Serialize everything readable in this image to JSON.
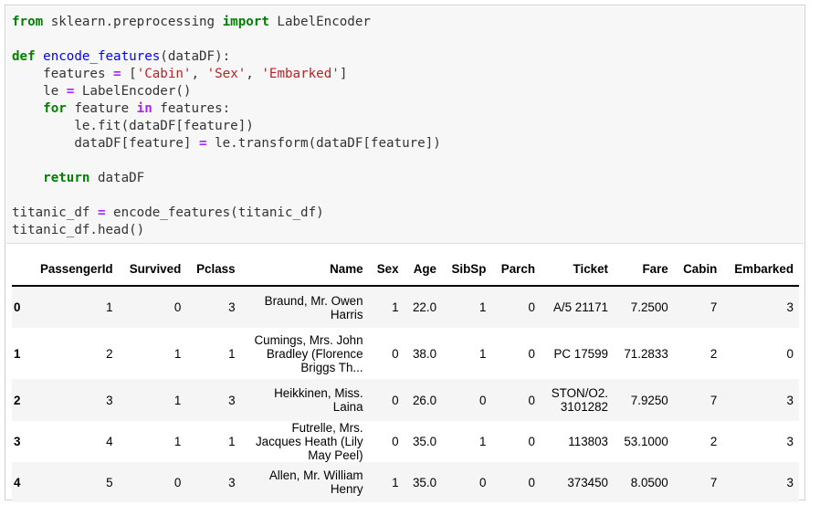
{
  "code": {
    "lines": [
      [
        {
          "t": "from",
          "c": "kw"
        },
        {
          "t": " sklearn.preprocessing "
        },
        {
          "t": "import",
          "c": "kw"
        },
        {
          "t": " LabelEncoder"
        }
      ],
      [],
      [
        {
          "t": "def",
          "c": "kw"
        },
        {
          "t": " "
        },
        {
          "t": "encode_features",
          "c": "fn"
        },
        {
          "t": "(dataDF):"
        }
      ],
      [
        {
          "t": "    features "
        },
        {
          "t": "=",
          "c": "op"
        },
        {
          "t": " ["
        },
        {
          "t": "'Cabin'",
          "c": "st"
        },
        {
          "t": ", "
        },
        {
          "t": "'Sex'",
          "c": "st"
        },
        {
          "t": ", "
        },
        {
          "t": "'Embarked'",
          "c": "st"
        },
        {
          "t": "]"
        }
      ],
      [
        {
          "t": "    le "
        },
        {
          "t": "=",
          "c": "op"
        },
        {
          "t": " LabelEncoder()"
        }
      ],
      [
        {
          "t": "    "
        },
        {
          "t": "for",
          "c": "kw"
        },
        {
          "t": " feature "
        },
        {
          "t": "in",
          "c": "op"
        },
        {
          "t": " features:"
        }
      ],
      [
        {
          "t": "        le.fit(dataDF[feature])"
        }
      ],
      [
        {
          "t": "        dataDF[feature] "
        },
        {
          "t": "=",
          "c": "op"
        },
        {
          "t": " le.transform(dataDF[feature])"
        }
      ],
      [],
      [
        {
          "t": "    "
        },
        {
          "t": "return",
          "c": "kw"
        },
        {
          "t": " dataDF"
        }
      ],
      [],
      [
        {
          "t": "titanic_df "
        },
        {
          "t": "=",
          "c": "op"
        },
        {
          "t": " encode_features(titanic_df)"
        }
      ],
      [
        {
          "t": "titanic_df.head()"
        }
      ]
    ]
  },
  "table": {
    "columns": [
      "PassengerId",
      "Survived",
      "Pclass",
      "Name",
      "Sex",
      "Age",
      "SibSp",
      "Parch",
      "Ticket",
      "Fare",
      "Cabin",
      "Embarked"
    ],
    "rows": [
      {
        "index": "0",
        "cells": [
          "1",
          "0",
          "3",
          "Braund, Mr. Owen Harris",
          "1",
          "22.0",
          "1",
          "0",
          "A/5 21171",
          "7.2500",
          "7",
          "3"
        ]
      },
      {
        "index": "1",
        "cells": [
          "2",
          "1",
          "1",
          "Cumings, Mrs. John Bradley (Florence Briggs Th...",
          "0",
          "38.0",
          "1",
          "0",
          "PC 17599",
          "71.2833",
          "2",
          "0"
        ]
      },
      {
        "index": "2",
        "cells": [
          "3",
          "1",
          "3",
          "Heikkinen, Miss. Laina",
          "0",
          "26.0",
          "0",
          "0",
          "STON/O2. 3101282",
          "7.9250",
          "7",
          "3"
        ]
      },
      {
        "index": "3",
        "cells": [
          "4",
          "1",
          "1",
          "Futrelle, Mrs. Jacques Heath (Lily May Peel)",
          "0",
          "35.0",
          "1",
          "0",
          "113803",
          "53.1000",
          "2",
          "3"
        ]
      },
      {
        "index": "4",
        "cells": [
          "5",
          "0",
          "3",
          "Allen, Mr. William Henry",
          "1",
          "35.0",
          "0",
          "0",
          "373450",
          "8.0500",
          "7",
          "3"
        ]
      }
    ]
  }
}
